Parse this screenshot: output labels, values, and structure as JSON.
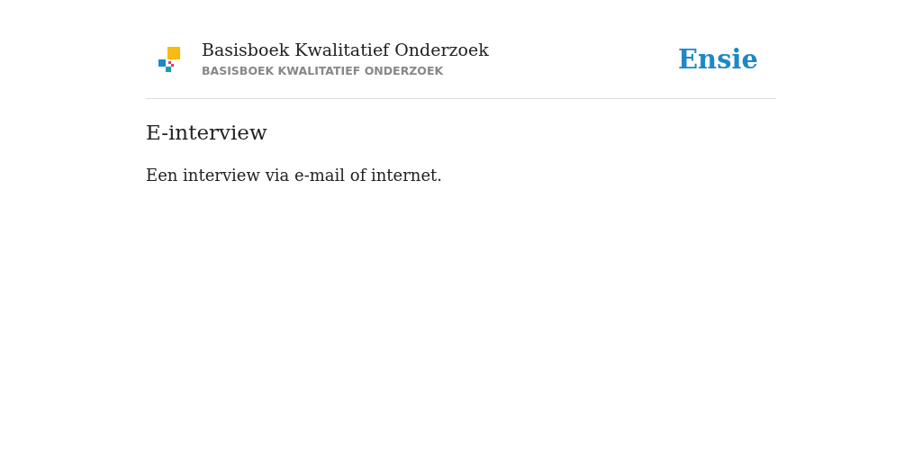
{
  "header": {
    "title": "Basisboek Kwalitatief Onderzoek",
    "subtitle": "BASISBOEK KWALITATIEF ONDERZOEK",
    "brand": "Ensie"
  },
  "entry": {
    "heading": "E-interview",
    "definition": "Een interview via e-mail of internet."
  }
}
